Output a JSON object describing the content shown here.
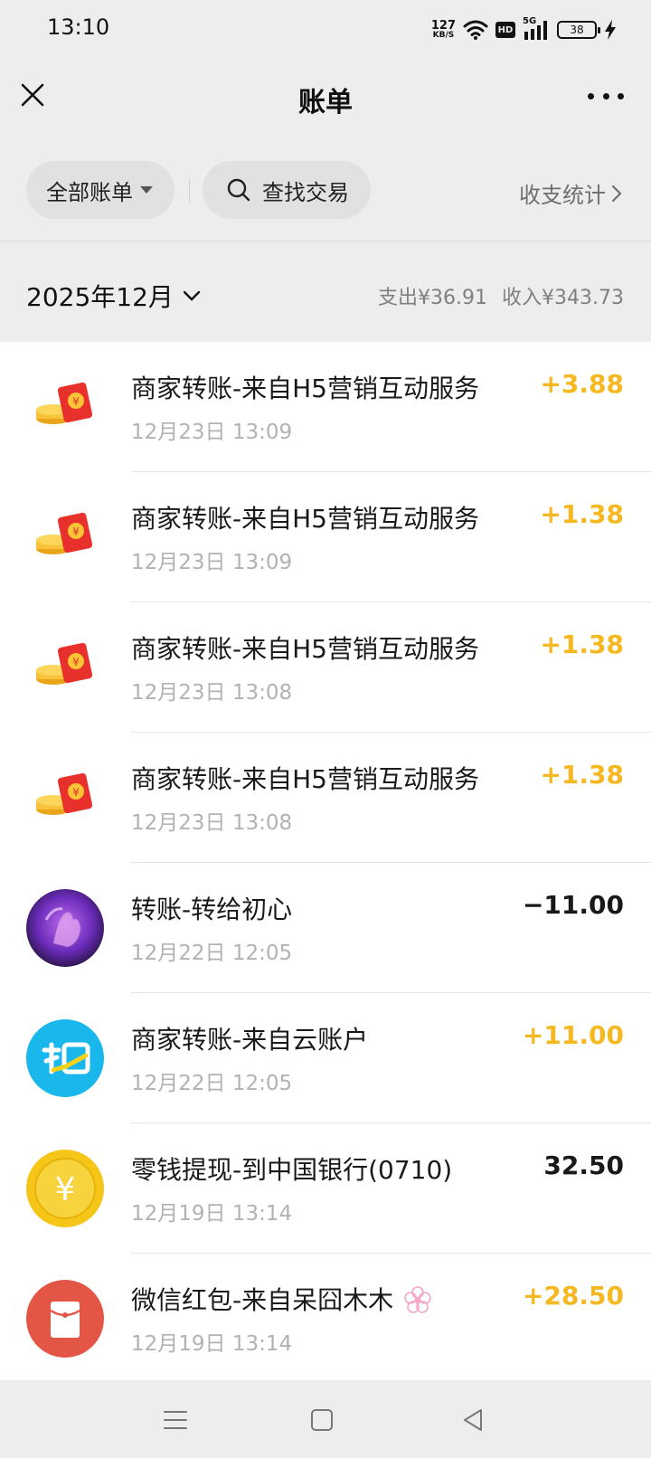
{
  "status_bar": {
    "time": "13:10",
    "net_speed_value": "127",
    "net_speed_unit": "KB/S",
    "hd_label": "HD",
    "signal_label": "5G",
    "battery_level": "38"
  },
  "header": {
    "title": "账单"
  },
  "filters": {
    "all_bills": "全部账单",
    "search_label": "查找交易",
    "stats_link": "收支统计"
  },
  "month": {
    "label": "2025年12月",
    "expense": "支出¥36.91",
    "income": "收入¥343.73"
  },
  "transactions": [
    {
      "icon": "red-packet-coins-icon",
      "title": "商家转账-来自H5营销互动服务",
      "time": "12月23日 13:09",
      "amount": "+3.88",
      "type": "income"
    },
    {
      "icon": "red-packet-coins-icon",
      "title": "商家转账-来自H5营销互动服务",
      "time": "12月23日 13:09",
      "amount": "+1.38",
      "type": "income"
    },
    {
      "icon": "red-packet-coins-icon",
      "title": "商家转账-来自H5营销互动服务",
      "time": "12月23日 13:08",
      "amount": "+1.38",
      "type": "income"
    },
    {
      "icon": "red-packet-coins-icon",
      "title": "商家转账-来自H5营销互动服务",
      "time": "12月23日 13:08",
      "amount": "+1.38",
      "type": "income"
    },
    {
      "icon": "user-avatar",
      "title": "转账-转给初心",
      "time": "12月22日 12:05",
      "amount": "−11.00",
      "type": "expense"
    },
    {
      "icon": "merchant-logo-icon",
      "title": "商家转账-来自云账户",
      "time": "12月22日 12:05",
      "amount": "+11.00",
      "type": "income"
    },
    {
      "icon": "yuan-coin-icon",
      "title": "零钱提现-到中国银行(0710)",
      "time": "12月19日 13:14",
      "amount": "32.50",
      "type": "expense"
    },
    {
      "icon": "red-envelope-icon",
      "title": "微信红包-来自呆囧木木",
      "time": "12月19日 13:14",
      "amount": "+28.50",
      "type": "income"
    }
  ],
  "colors": {
    "income": "#f5b820",
    "expense": "#191919",
    "background": "#ededed"
  }
}
